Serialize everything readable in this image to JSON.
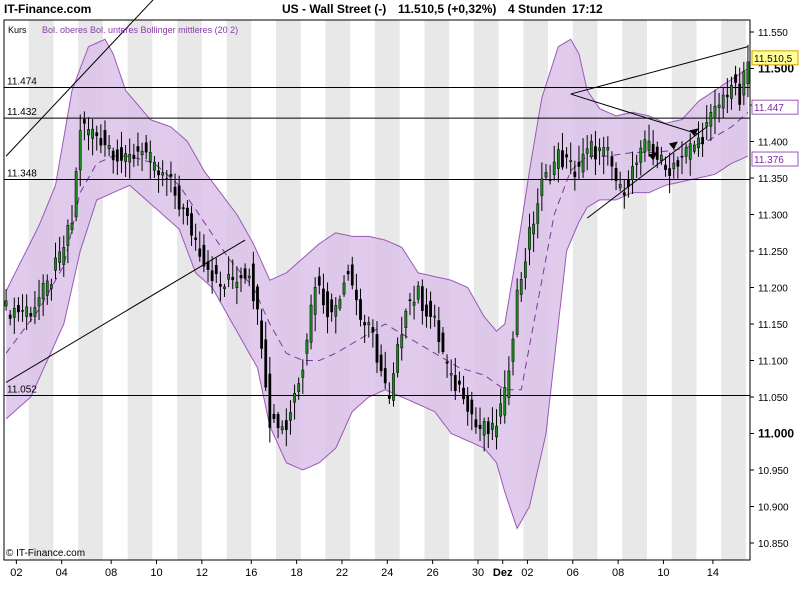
{
  "header": {
    "brand": "IT-Finance.com",
    "instrument": "US - Wall Street (-)",
    "last": "11.510,5 (+0,32%)",
    "interval": "4 Stunden",
    "time": "17:12"
  },
  "legend": {
    "kurs": "Kurs",
    "bollinger": "Bol. oberes Bol. unteres Bollinger mittleres (20 2)"
  },
  "copyright": "© IT-Finance.com",
  "colors": {
    "band_fill": "#dcc2ea",
    "band_edge": "#9a58b8",
    "mid_line": "#7a3a9a",
    "candle_up": "#1a8a1a",
    "candle_down": "#000000",
    "alt_column": "#e8e8e8",
    "price_badge": "#ffff99",
    "price_badge_border": "#d0a000",
    "band_badge_border": "#9a58b8"
  },
  "chart_data": {
    "type": "candlestick",
    "title": "US - Wall Street (-)",
    "ylim": [
      10830,
      11580
    ],
    "y_ticks": [
      "11.550",
      "11.500",
      "11.450",
      "11.400",
      "11.350",
      "11.300",
      "11.250",
      "11.200",
      "11.150",
      "11.100",
      "11.050",
      "11.000",
      "10.950",
      "10.900",
      "10.850"
    ],
    "y_tick_values": [
      11550,
      11500,
      11450,
      11400,
      11350,
      11300,
      11250,
      11200,
      11150,
      11100,
      11050,
      11000,
      10950,
      10900,
      10850
    ],
    "x_tick_labels": [
      "02",
      "04",
      "08",
      "10",
      "12",
      "16",
      "18",
      "22",
      "24",
      "26",
      "30",
      "Dez",
      "02",
      "06",
      "08",
      "10",
      "14"
    ],
    "x_tick_index": [
      3,
      14,
      26,
      37,
      48,
      60,
      71,
      82,
      93,
      104,
      115,
      121,
      127,
      138,
      149,
      160,
      172
    ],
    "horizontal_levels": [
      {
        "label": "11.474",
        "value": 11474
      },
      {
        "label": "11.432",
        "value": 11432
      },
      {
        "label": "11.348",
        "value": 11348
      },
      {
        "label": "11.052",
        "value": 11052
      }
    ],
    "current_price_label": "11.510,5",
    "current_price": 11510.5,
    "upper_band_label": "11.447",
    "upper_band_value": 11447,
    "lower_band_label": "11.376",
    "lower_band_value": 11376,
    "candle_count": 181,
    "close_anchors": [
      [
        0,
        11170
      ],
      [
        6,
        11170
      ],
      [
        10,
        11200
      ],
      [
        13,
        11240
      ],
      [
        16,
        11290
      ],
      [
        18,
        11420
      ],
      [
        22,
        11410
      ],
      [
        25,
        11395
      ],
      [
        29,
        11370
      ],
      [
        33,
        11395
      ],
      [
        36,
        11360
      ],
      [
        40,
        11340
      ],
      [
        44,
        11290
      ],
      [
        48,
        11240
      ],
      [
        52,
        11200
      ],
      [
        56,
        11215
      ],
      [
        59,
        11225
      ],
      [
        62,
        11130
      ],
      [
        64,
        11020
      ],
      [
        68,
        11010
      ],
      [
        72,
        11100
      ],
      [
        75,
        11210
      ],
      [
        79,
        11160
      ],
      [
        83,
        11230
      ],
      [
        86,
        11160
      ],
      [
        89,
        11130
      ],
      [
        93,
        11040
      ],
      [
        97,
        11180
      ],
      [
        100,
        11190
      ],
      [
        104,
        11150
      ],
      [
        108,
        11070
      ],
      [
        111,
        11060
      ],
      [
        114,
        11010
      ],
      [
        118,
        11000
      ],
      [
        121,
        11050
      ],
      [
        124,
        11190
      ],
      [
        127,
        11270
      ],
      [
        130,
        11340
      ],
      [
        134,
        11380
      ],
      [
        138,
        11360
      ],
      [
        142,
        11390
      ],
      [
        146,
        11380
      ],
      [
        149,
        11330
      ],
      [
        153,
        11370
      ],
      [
        156,
        11400
      ],
      [
        160,
        11360
      ],
      [
        164,
        11380
      ],
      [
        168,
        11400
      ],
      [
        172,
        11440
      ],
      [
        176,
        11480
      ],
      [
        178,
        11455
      ],
      [
        180,
        11510
      ]
    ],
    "upper_anchors": [
      [
        0,
        11195
      ],
      [
        8,
        11285
      ],
      [
        12,
        11340
      ],
      [
        16,
        11470
      ],
      [
        20,
        11530
      ],
      [
        24,
        11540
      ],
      [
        26,
        11520
      ],
      [
        29,
        11470
      ],
      [
        32,
        11450
      ],
      [
        35,
        11430
      ],
      [
        40,
        11420
      ],
      [
        44,
        11400
      ],
      [
        48,
        11360
      ],
      [
        52,
        11330
      ],
      [
        56,
        11300
      ],
      [
        60,
        11260
      ],
      [
        64,
        11210
      ],
      [
        68,
        11220
      ],
      [
        72,
        11240
      ],
      [
        76,
        11260
      ],
      [
        80,
        11275
      ],
      [
        84,
        11270
      ],
      [
        88,
        11270
      ],
      [
        92,
        11265
      ],
      [
        96,
        11255
      ],
      [
        100,
        11220
      ],
      [
        104,
        11215
      ],
      [
        108,
        11210
      ],
      [
        112,
        11200
      ],
      [
        116,
        11160
      ],
      [
        119,
        11140
      ],
      [
        121,
        11150
      ],
      [
        124,
        11250
      ],
      [
        127,
        11360
      ],
      [
        130,
        11460
      ],
      [
        134,
        11530
      ],
      [
        137,
        11540
      ],
      [
        139,
        11520
      ],
      [
        141,
        11470
      ],
      [
        144,
        11445
      ],
      [
        148,
        11435
      ],
      [
        152,
        11440
      ],
      [
        156,
        11435
      ],
      [
        160,
        11425
      ],
      [
        164,
        11430
      ],
      [
        168,
        11455
      ],
      [
        172,
        11470
      ],
      [
        176,
        11485
      ],
      [
        180,
        11500
      ]
    ],
    "lower_anchors": [
      [
        0,
        11020
      ],
      [
        6,
        11050
      ],
      [
        10,
        11100
      ],
      [
        14,
        11150
      ],
      [
        18,
        11250
      ],
      [
        22,
        11320
      ],
      [
        26,
        11330
      ],
      [
        30,
        11340
      ],
      [
        34,
        11320
      ],
      [
        38,
        11300
      ],
      [
        42,
        11280
      ],
      [
        46,
        11220
      ],
      [
        50,
        11200
      ],
      [
        54,
        11160
      ],
      [
        58,
        11120
      ],
      [
        61,
        11090
      ],
      [
        64,
        11010
      ],
      [
        68,
        10960
      ],
      [
        72,
        10950
      ],
      [
        76,
        10960
      ],
      [
        80,
        10980
      ],
      [
        84,
        11030
      ],
      [
        88,
        11050
      ],
      [
        92,
        11060
      ],
      [
        96,
        11050
      ],
      [
        100,
        11040
      ],
      [
        104,
        11030
      ],
      [
        108,
        11000
      ],
      [
        112,
        10990
      ],
      [
        116,
        10980
      ],
      [
        119,
        10960
      ],
      [
        121,
        10920
      ],
      [
        124,
        10870
      ],
      [
        127,
        10900
      ],
      [
        131,
        11000
      ],
      [
        136,
        11250
      ],
      [
        139,
        11290
      ],
      [
        141,
        11310
      ],
      [
        144,
        11320
      ],
      [
        148,
        11320
      ],
      [
        152,
        11330
      ],
      [
        156,
        11330
      ],
      [
        160,
        11340
      ],
      [
        164,
        11345
      ],
      [
        168,
        11350
      ],
      [
        172,
        11355
      ],
      [
        176,
        11370
      ],
      [
        180,
        11380
      ]
    ],
    "mid_anchors": [
      [
        0,
        11110
      ],
      [
        8,
        11170
      ],
      [
        14,
        11230
      ],
      [
        18,
        11330
      ],
      [
        22,
        11370
      ],
      [
        26,
        11380
      ],
      [
        30,
        11380
      ],
      [
        36,
        11370
      ],
      [
        42,
        11340
      ],
      [
        48,
        11290
      ],
      [
        54,
        11240
      ],
      [
        60,
        11200
      ],
      [
        64,
        11150
      ],
      [
        68,
        11110
      ],
      [
        72,
        11100
      ],
      [
        76,
        11100
      ],
      [
        80,
        11110
      ],
      [
        86,
        11130
      ],
      [
        92,
        11150
      ],
      [
        98,
        11130
      ],
      [
        104,
        11110
      ],
      [
        110,
        11090
      ],
      [
        116,
        11080
      ],
      [
        121,
        11060
      ],
      [
        125,
        11060
      ],
      [
        129,
        11180
      ],
      [
        133,
        11300
      ],
      [
        137,
        11360
      ],
      [
        141,
        11380
      ],
      [
        146,
        11380
      ],
      [
        152,
        11385
      ],
      [
        158,
        11385
      ],
      [
        164,
        11390
      ],
      [
        170,
        11400
      ],
      [
        176,
        11420
      ],
      [
        180,
        11440
      ]
    ],
    "trendlines": [
      {
        "from": [
          0,
          11380
        ],
        "to": [
          45,
          11650
        ]
      },
      {
        "from": [
          0,
          11070
        ],
        "to": [
          58,
          11265
        ]
      },
      {
        "from": [
          137,
          11465
        ],
        "to": [
          180,
          11530
        ]
      },
      {
        "from": [
          137,
          11465
        ],
        "to": [
          168,
          11410
        ]
      },
      {
        "from": [
          141,
          11295
        ],
        "to": [
          170,
          11420
        ]
      }
    ]
  }
}
